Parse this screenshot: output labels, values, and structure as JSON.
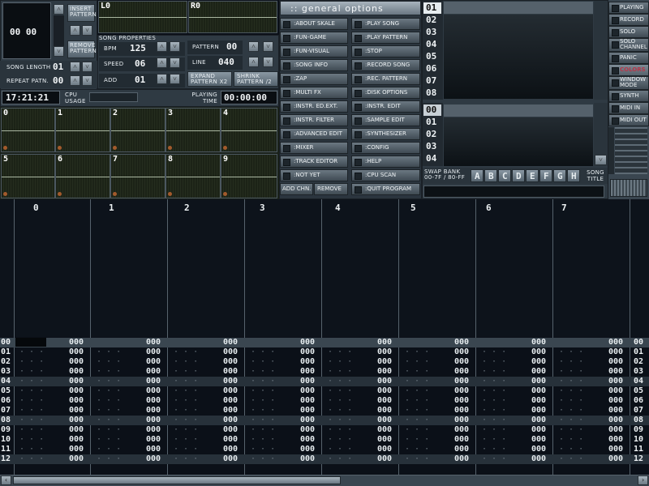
{
  "top_left": {
    "position_value": "00 00",
    "insert_pattern": "INSERT PATTERN",
    "remove_pattern": "REMOVE PATTERN",
    "song_length_label": "SONG LENGTH",
    "song_length_value": "01",
    "repeat_patn_label": "REPEAT PATN.",
    "repeat_patn_value": "00"
  },
  "vu": {
    "left": "L0",
    "right": "R0"
  },
  "song_properties": {
    "title": "SONG PROPERTIES",
    "bpm_label": "BPM",
    "bpm_value": "125",
    "speed_label": "SPEED",
    "speed_value": "06",
    "add_label": "ADD",
    "add_value": "01",
    "pattern_label": "PATTERN",
    "pattern_value": "00",
    "line_label": "LINE",
    "line_value": "040",
    "expand_label": "EXPAND PATTERN X2",
    "shrink_label": "SHRINK PATTERN /2"
  },
  "status": {
    "clock": "17:21:21",
    "cpu_label": "CPU USAGE",
    "playing_time_label": "PLAYING TIME",
    "playing_time": "00:00:00"
  },
  "scopes": [
    "0",
    "1",
    "2",
    "3",
    "4",
    "5",
    "6",
    "7",
    "8",
    "9"
  ],
  "general_options": {
    "title": ":: general options",
    "left_buttons": [
      ":ABOUT SKALE",
      ":FUN-GAME",
      ":FUN-VISUAL",
      ":SONG INFO",
      ":ZAP",
      ":MULTI FX",
      ":INSTR. ED.EXT.",
      ":INSTR. FILTER",
      ":ADVANCED EDIT",
      ":MIXER",
      ":TRACK EDITOR",
      ":NOT YET"
    ],
    "right_buttons": [
      ":PLAY SONG",
      ":PLAY PATTERN",
      ":STOP",
      ":RECORD SONG",
      ":REC. PATTERN",
      ":DISK OPTIONS",
      ":INSTR. EDIT",
      ":SAMPLE EDIT",
      ":SYNTHESIZER",
      ":CONFIG",
      ":HELP",
      ":CPU SCAN",
      ":QUIT PROGRAM"
    ],
    "add_chn": "ADD CHN.",
    "remove": "REMOVE"
  },
  "instruments": [
    "01",
    "02",
    "03",
    "04",
    "05",
    "06",
    "07",
    "08"
  ],
  "samples": [
    "00",
    "01",
    "02",
    "03",
    "04"
  ],
  "bank": {
    "swap_label": "SWAP BANK 00-7F / 80-FF",
    "letters": [
      "A",
      "B",
      "C",
      "D",
      "E",
      "F",
      "G",
      "H"
    ],
    "song_title_label": "SONG TITLE"
  },
  "right_buttons": [
    "PLAYING",
    "RECORD",
    "SOLO",
    "SOLO CHANNEL",
    "PANIC",
    "COLORS",
    "WINDOW MODE",
    "SYNTH",
    "MIDI IN",
    "MIDI OUT"
  ],
  "channels": [
    "0",
    "1",
    "2",
    "3",
    "4",
    "5",
    "6",
    "7"
  ],
  "pattern_rows": [
    "00",
    "01",
    "02",
    "03",
    "04",
    "05",
    "06",
    "07",
    "08",
    "09",
    "10",
    "11",
    "12"
  ],
  "volume_value": "000",
  "colors": {
    "accent_red": "#b5374a",
    "scope_green": "#252d1e",
    "orange_led": "#a35a2c"
  }
}
